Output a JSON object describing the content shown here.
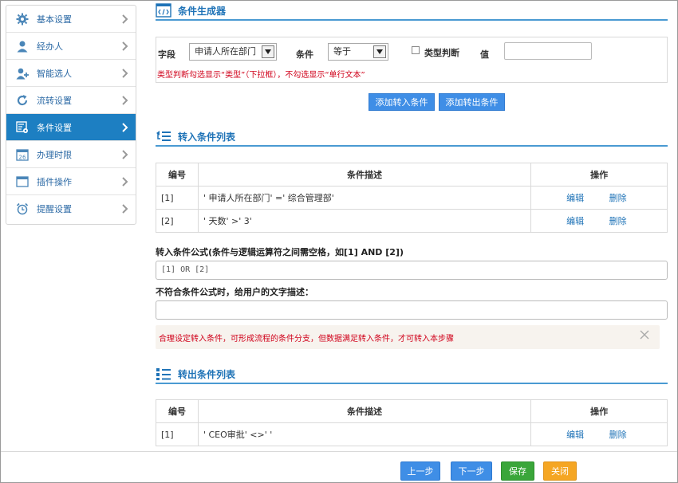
{
  "sidebar": {
    "items": [
      {
        "label": "基本设置",
        "icon": "gear-icon"
      },
      {
        "label": "经办人",
        "icon": "user-icon"
      },
      {
        "label": "智能选人",
        "icon": "user-plus-icon"
      },
      {
        "label": "流转设置",
        "icon": "refresh-icon"
      },
      {
        "label": "条件设置",
        "icon": "condition-settings-icon",
        "active": true
      },
      {
        "label": "办理时限",
        "icon": "calendar-icon",
        "badge": "26"
      },
      {
        "label": "插件操作",
        "icon": "window-icon"
      },
      {
        "label": "提醒设置",
        "icon": "alarm-clock-icon"
      }
    ]
  },
  "generator": {
    "title": "条件生成器",
    "field_label": "字段",
    "field_value": "申请人所在部门",
    "condition_label": "条件",
    "condition_value": "等于",
    "type_check_label": "类型判断",
    "value_label": "值",
    "hint": "类型判断勾选显示“类型”（下拉框），不勾选显示“单行文本”",
    "add_in_button": "添加转入条件",
    "add_out_button": "添加转出条件"
  },
  "in_list": {
    "title": "转入条件列表",
    "columns": [
      "编号",
      "条件描述",
      "操作"
    ],
    "rows": [
      {
        "id": "[1]",
        "desc": "' 申请人所在部门' =' 综合管理部'",
        "edit": "编辑",
        "delete": "删除"
      },
      {
        "id": "[2]",
        "desc": "' 天数' >' 3'",
        "edit": "编辑",
        "delete": "删除"
      }
    ]
  },
  "formula": {
    "label": "转入条件公式(条件与逻辑运算符之间需空格，如[1] AND [2])",
    "value": "[1] OR [2]",
    "desc_label": "不符合条件公式时，给用户的文字描述：",
    "desc_value": "",
    "warning": "合理设定转入条件，可形成流程的条件分支，但数据满足转入条件，才可转入本步骤"
  },
  "out_list": {
    "title": "转出条件列表",
    "columns": [
      "编号",
      "条件描述",
      "操作"
    ],
    "rows": [
      {
        "id": "[1]",
        "desc": "' CEO审批' <>' '",
        "edit": "编辑",
        "delete": "删除"
      }
    ]
  },
  "footer": {
    "prev": "上一步",
    "next": "下一步",
    "save": "保存",
    "close": "关闭"
  },
  "colors": {
    "accent": "#1d7fc2",
    "save": "#3aa63a",
    "close": "#f5a623",
    "warning_text": "#d0021b"
  }
}
